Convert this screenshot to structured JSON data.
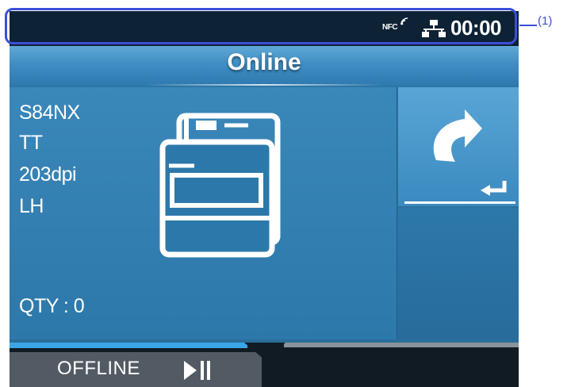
{
  "status_bar": {
    "nfc_label": "NFC",
    "time": "00:00"
  },
  "callout": {
    "label": "(1)"
  },
  "title": "Online",
  "printer_info": {
    "model": "S84NX",
    "print_method": "TT",
    "resolution": "203dpi",
    "side": "LH",
    "quantity": "QTY : 0"
  },
  "footer": {
    "offline_label": "OFFLINE"
  },
  "colors": {
    "status_bar_bg": "#0e2235",
    "panel_blue": "#2f79a8",
    "progress_blue": "#3aa6e6",
    "callout_blue": "#3b4fd8",
    "footer_button": "#525b63"
  },
  "icons": {
    "nfc": "nfc-signal-icon",
    "network": "network-icon",
    "printer": "printer-icon",
    "return": "return-arrow-icon",
    "play_pause": "play-pause-icon"
  }
}
